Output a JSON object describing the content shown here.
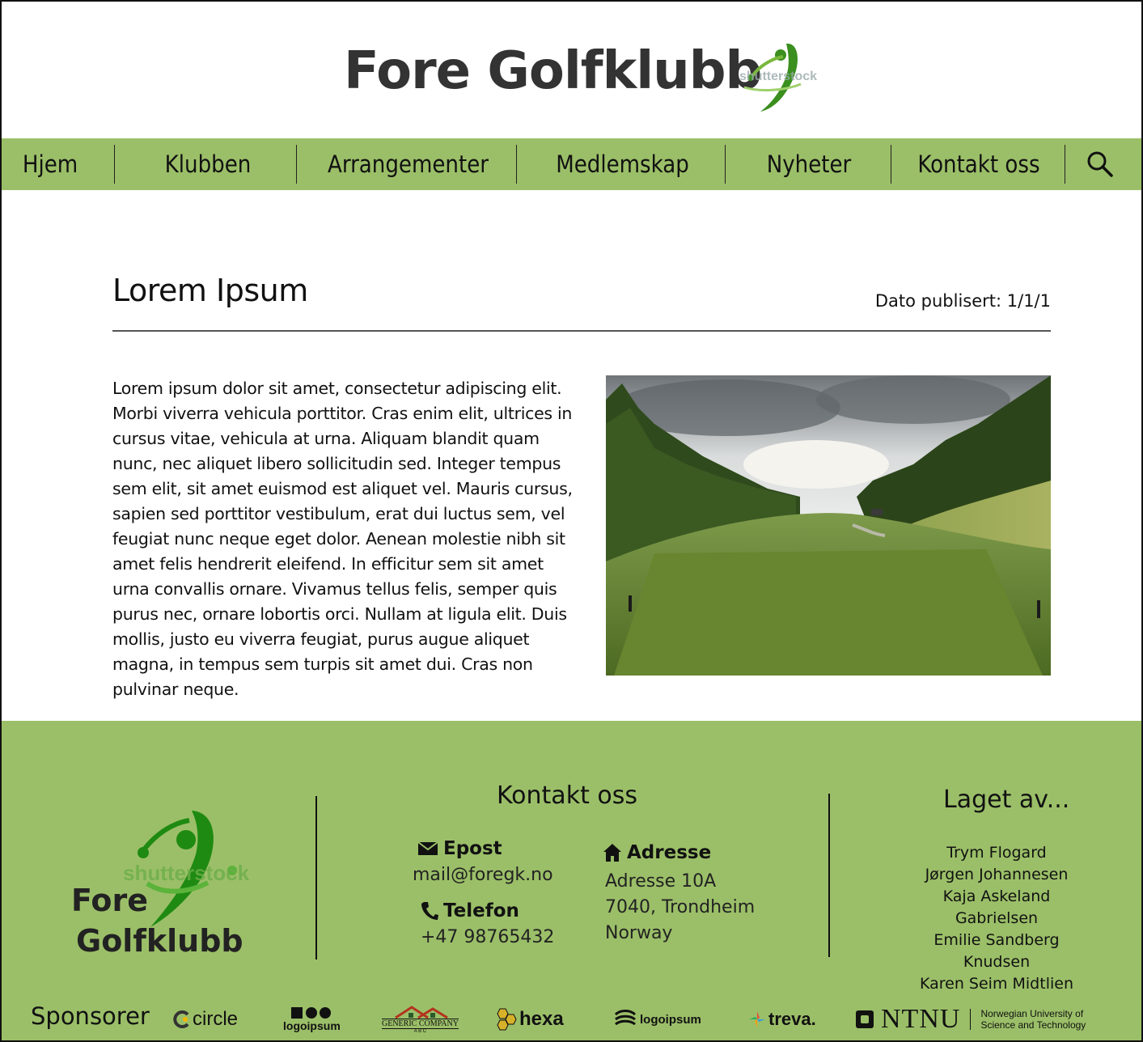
{
  "header": {
    "site_title": "Fore Golfklubb",
    "logo_watermark": "shutterstock",
    "logo_icon": "golfer-swing-logo"
  },
  "nav": {
    "items": [
      {
        "label": "Hjem"
      },
      {
        "label": "Klubben"
      },
      {
        "label": "Arrangementer"
      },
      {
        "label": "Medlemskap"
      },
      {
        "label": "Nyheter"
      },
      {
        "label": "Kontakt oss"
      }
    ],
    "search_icon": "search-icon"
  },
  "article": {
    "title": "Lorem Ipsum",
    "date_published": "Dato publisert: 1/1/1",
    "body": "Lorem ipsum dolor sit amet, consectetur adipiscing elit. Morbi viverra vehicula porttitor. Cras enim elit, ultrices in cursus vitae, vehicula at urna. Aliquam blandit quam nunc, nec aliquet libero sollicitudin sed. Integer tempus sem elit, sit amet euismod est aliquet vel. Mauris cursus, sapien sed porttitor vestibulum, erat dui luctus sem, vel feugiat nunc neque eget dolor. Aenean molestie nibh sit amet felis hendrerit eleifend. In efficitur sem sit amet urna convallis ornare. Vivamus tellus felis, semper quis purus nec, ornare lobortis orci. Nullam at ligula elit. Duis mollis, justo eu viverra feugiat, purus augue aliquet magna, in tempus sem turpis sit amet dui. Cras non pulvinar neque.",
    "image": "golf-course-fairway-photo"
  },
  "footer": {
    "logo_line1": "Fore",
    "logo_line2": "Golfklubb",
    "logo_watermark": "shutterstock",
    "contact": {
      "heading": "Kontakt oss",
      "email_label": "Epost",
      "email_value": "mail@foregk.no",
      "phone_label": "Telefon",
      "phone_value": "+47 98765432",
      "address_label": "Adresse",
      "address_lines": [
        "Adresse 10A",
        "7040, Trondheim",
        "Norway"
      ]
    },
    "made_by": {
      "heading": "Laget av...",
      "members": [
        "Trym Flogard",
        "Jørgen Johannesen",
        "Kaja Askeland Gabrielsen",
        "Emilie Sandberg Knudsen",
        "Karen Seim Midtlien"
      ]
    },
    "sponsors_label": "Sponsorer",
    "sponsors": {
      "circle": "circle",
      "logoipsum1": "logoipsum",
      "generic": "GENERIC COMPANY",
      "generic_sub": "A B C",
      "hexa": "hexa",
      "logoipsum2": "logoipsum",
      "treva": "treva.",
      "ntnu": "NTNU",
      "ntnu_sub1": "Norwegian University of",
      "ntnu_sub2": "Science and Technology"
    }
  },
  "colors": {
    "nav_green": "#9bbf68",
    "logo_green": "#2e8b1e",
    "title_gray": "#333333"
  }
}
